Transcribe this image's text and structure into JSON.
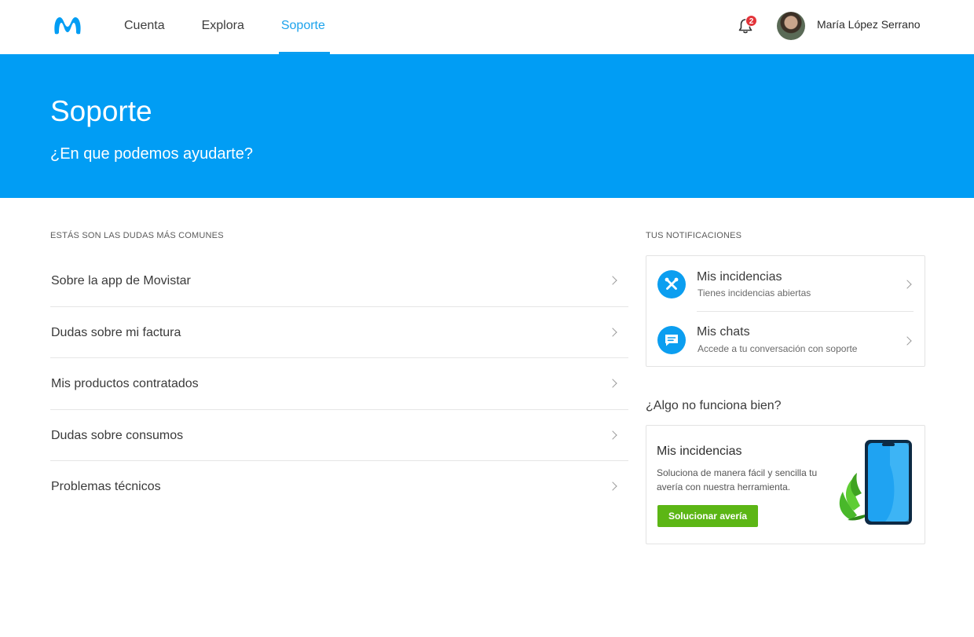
{
  "header": {
    "logo_name": "movistar-logo",
    "nav": [
      {
        "label": "Cuenta",
        "active": false
      },
      {
        "label": "Explora",
        "active": false
      },
      {
        "label": "Soporte",
        "active": true
      }
    ],
    "notifications_count": "2",
    "user_name": "María López Serrano"
  },
  "hero": {
    "title": "Soporte",
    "subtitle": "¿En que podemos ayudarte?"
  },
  "faq": {
    "heading": "ESTÁS SON LAS DUDAS MÁS COMUNES",
    "items": [
      "Sobre la app de Movistar",
      "Dudas sobre mi factura",
      "Mis productos contratados",
      "Dudas sobre consumos",
      "Problemas técnicos"
    ]
  },
  "notifications": {
    "heading": "TUS NOTIFICACIONES",
    "items": [
      {
        "title": "Mis incidencias",
        "subtitle": "Tienes incidencias abiertas",
        "icon": "tools-icon"
      },
      {
        "title": "Mis chats",
        "subtitle": "Accede a tu conversación con soporte",
        "icon": "chat-icon"
      }
    ]
  },
  "help": {
    "question": "¿Algo no funciona bien?",
    "card_title": "Mis incidencias",
    "card_text": "Soluciona de manera fácil y sencilla tu avería con nuestra herramienta.",
    "button_label": "Solucionar avería"
  },
  "colors": {
    "brand_blue": "#019df4",
    "accent_blue": "#0b9ef0",
    "button_green": "#5cb615",
    "badge_red": "#e3343a"
  }
}
